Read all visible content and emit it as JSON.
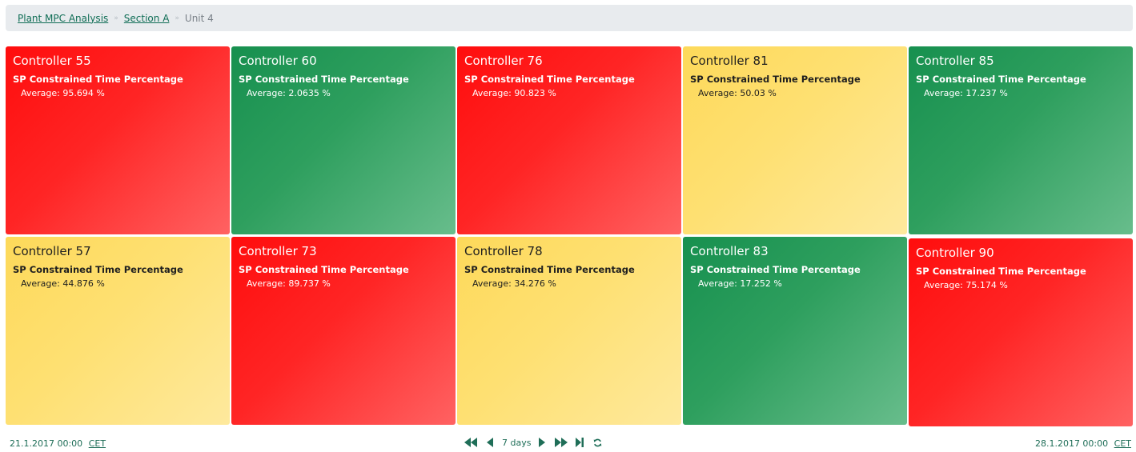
{
  "breadcrumb": {
    "items": [
      "Plant MPC Analysis",
      "Section A"
    ],
    "separator": "»",
    "current": "Unit 4"
  },
  "colors": {
    "red": "#ff1a1a",
    "green": "#1f9a55",
    "yellow": "#fddc67",
    "accent": "#0f6d55"
  },
  "tiles": [
    {
      "title": "Controller 55",
      "metric": "SP Constrained Time Percentage",
      "average": "Average: 95.694 %",
      "status": "red"
    },
    {
      "title": "Controller 60",
      "metric": "SP Constrained Time Percentage",
      "average": "Average: 2.0635 %",
      "status": "green"
    },
    {
      "title": "Controller 76",
      "metric": "SP Constrained Time Percentage",
      "average": "Average: 90.823 %",
      "status": "red"
    },
    {
      "title": "Controller 81",
      "metric": "SP Constrained Time Percentage",
      "average": "Average: 50.03 %",
      "status": "yellow"
    },
    {
      "title": "Controller 85",
      "metric": "SP Constrained Time Percentage",
      "average": "Average: 17.237 %",
      "status": "green"
    },
    {
      "title": "Controller 57",
      "metric": "SP Constrained Time Percentage",
      "average": "Average: 44.876 %",
      "status": "yellow"
    },
    {
      "title": "Controller 73",
      "metric": "SP Constrained Time Percentage",
      "average": "Average: 89.737 %",
      "status": "red"
    },
    {
      "title": "Controller 78",
      "metric": "SP Constrained Time Percentage",
      "average": "Average: 34.276 %",
      "status": "yellow"
    },
    {
      "title": "Controller 83",
      "metric": "SP Constrained Time Percentage",
      "average": "Average: 17.252 %",
      "status": "green"
    },
    {
      "title": "Controller 90",
      "metric": "SP Constrained Time Percentage",
      "average": "Average: 75.174 %",
      "status": "red"
    }
  ],
  "footer": {
    "start_date": "21.1.2017 00:00",
    "end_date": "28.1.2017 00:00",
    "timezone": "CET",
    "range_label": "7 days",
    "icons": [
      "fast-backward-icon",
      "step-backward-icon",
      "step-forward-icon",
      "fast-forward-icon",
      "skip-to-end-icon",
      "refresh-icon"
    ]
  }
}
